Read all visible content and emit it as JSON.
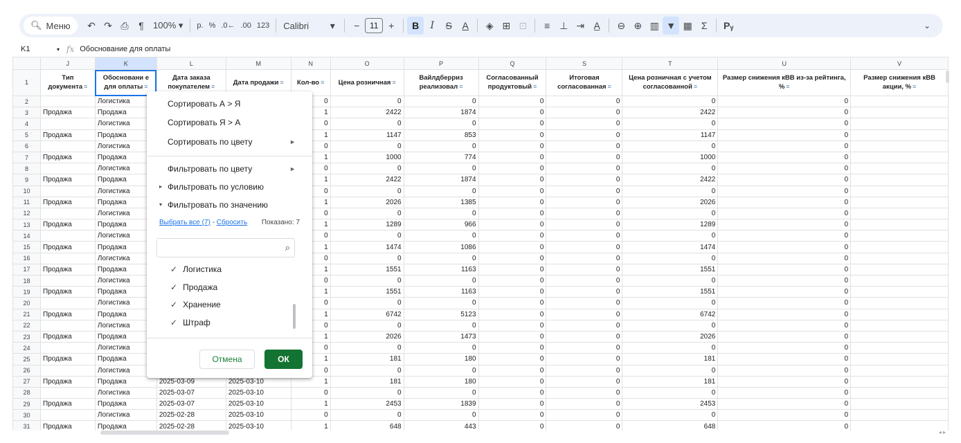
{
  "toolbar": {
    "menu_label": "Меню",
    "zoom": "100%",
    "currency": "р.",
    "percent": "%",
    "dec_less": ".0←",
    "dec_more": ".00",
    "format_num": "123",
    "font": "Calibri",
    "font_size": "11",
    "minus": "−",
    "plus": "+",
    "bold": "B",
    "italic": "I",
    "strike": "S",
    "textcolor": "A",
    "sigma": "Σ",
    "icons": [
      "search-icon",
      "undo-icon",
      "redo-icon",
      "print-icon",
      "paint-format-icon",
      "fill-color-icon",
      "borders-icon",
      "merge-icon",
      "align-icon",
      "valign-icon",
      "wrap-icon",
      "rotate-icon",
      "link-icon",
      "comment-icon",
      "chart-icon",
      "filter-icon",
      "filter-views-icon",
      "functions-icon",
      "input-tools-icon",
      "chevron-down-icon"
    ]
  },
  "formula_bar": {
    "cell": "K1",
    "fx": "fx",
    "content": "Обоснование для оплаты"
  },
  "columns": [
    {
      "letter": "J",
      "header": "Тип документа"
    },
    {
      "letter": "K",
      "header": "Обоснование для оплаты"
    },
    {
      "letter": "L",
      "header": "Дата заказа покупателем"
    },
    {
      "letter": "M",
      "header": "Дата продажи"
    },
    {
      "letter": "N",
      "header": "Кол-во"
    },
    {
      "letter": "O",
      "header": "Цена розничная"
    },
    {
      "letter": "P",
      "header": "Вайлдберриз реализовал"
    },
    {
      "letter": "Q",
      "header": "Согласованный продуктовый"
    },
    {
      "letter": "S",
      "header": "Итоговая согласованная"
    },
    {
      "letter": "T",
      "header": "Цена розничная с учетом согласованной"
    },
    {
      "letter": "U",
      "header": "Размер снижения кВВ из-за рейтинга, %"
    },
    {
      "letter": "V",
      "header": "Размер снижения кВВ акции, %"
    }
  ],
  "header_row": {
    "num": "1",
    "cells": [
      "Тип документа",
      "Обосновани е для оплаты",
      "Дата заказа покупателем",
      "Дата продажи",
      "Кол-во",
      "Цена розничная",
      "Вайлдберриз реализовал",
      "Согласованный продуктовый",
      "Итоговая согласованная",
      "Цена розничная с учетом согласованной",
      "Размер снижения кВВ из-за рейтинга, %",
      "Размер снижения кВВ акции, %"
    ]
  },
  "rows": [
    {
      "n": "2",
      "J": "",
      "K": "Логистика",
      "L": "",
      "M": "",
      "N": "0",
      "O": "0",
      "P": "0",
      "Q": "0",
      "S": "0",
      "T": "0",
      "U": "0"
    },
    {
      "n": "3",
      "J": "Продажа",
      "K": "Продажа",
      "L": "",
      "M": "",
      "N": "1",
      "O": "2422",
      "P": "1874",
      "Q": "0",
      "S": "0",
      "T": "2422",
      "U": "0"
    },
    {
      "n": "4",
      "J": "",
      "K": "Логистика",
      "L": "",
      "M": "",
      "N": "0",
      "O": "0",
      "P": "0",
      "Q": "0",
      "S": "0",
      "T": "0",
      "U": "0"
    },
    {
      "n": "5",
      "J": "Продажа",
      "K": "Продажа",
      "L": "",
      "M": "",
      "N": "1",
      "O": "1147",
      "P": "853",
      "Q": "0",
      "S": "0",
      "T": "1147",
      "U": "0"
    },
    {
      "n": "6",
      "J": "",
      "K": "Логистика",
      "L": "",
      "M": "",
      "N": "0",
      "O": "0",
      "P": "0",
      "Q": "0",
      "S": "0",
      "T": "0",
      "U": "0"
    },
    {
      "n": "7",
      "J": "Продажа",
      "K": "Продажа",
      "L": "",
      "M": "",
      "N": "1",
      "O": "1000",
      "P": "774",
      "Q": "0",
      "S": "0",
      "T": "1000",
      "U": "0"
    },
    {
      "n": "8",
      "J": "",
      "K": "Логистика",
      "L": "",
      "M": "",
      "N": "0",
      "O": "0",
      "P": "0",
      "Q": "0",
      "S": "0",
      "T": "0",
      "U": "0"
    },
    {
      "n": "9",
      "J": "Продажа",
      "K": "Продажа",
      "L": "",
      "M": "",
      "N": "1",
      "O": "2422",
      "P": "1874",
      "Q": "0",
      "S": "0",
      "T": "2422",
      "U": "0"
    },
    {
      "n": "10",
      "J": "",
      "K": "Логистика",
      "L": "",
      "M": "",
      "N": "0",
      "O": "0",
      "P": "0",
      "Q": "0",
      "S": "0",
      "T": "0",
      "U": "0"
    },
    {
      "n": "11",
      "J": "Продажа",
      "K": "Продажа",
      "L": "",
      "M": "",
      "N": "1",
      "O": "2026",
      "P": "1385",
      "Q": "0",
      "S": "0",
      "T": "2026",
      "U": "0"
    },
    {
      "n": "12",
      "J": "",
      "K": "Логистика",
      "L": "",
      "M": "",
      "N": "0",
      "O": "0",
      "P": "0",
      "Q": "0",
      "S": "0",
      "T": "0",
      "U": "0"
    },
    {
      "n": "13",
      "J": "Продажа",
      "K": "Продажа",
      "L": "",
      "M": "",
      "N": "1",
      "O": "1289",
      "P": "966",
      "Q": "0",
      "S": "0",
      "T": "1289",
      "U": "0"
    },
    {
      "n": "14",
      "J": "",
      "K": "Логистика",
      "L": "",
      "M": "",
      "N": "0",
      "O": "0",
      "P": "0",
      "Q": "0",
      "S": "0",
      "T": "0",
      "U": "0"
    },
    {
      "n": "15",
      "J": "Продажа",
      "K": "Продажа",
      "L": "",
      "M": "",
      "N": "1",
      "O": "1474",
      "P": "1086",
      "Q": "0",
      "S": "0",
      "T": "1474",
      "U": "0"
    },
    {
      "n": "16",
      "J": "",
      "K": "Логистика",
      "L": "",
      "M": "",
      "N": "0",
      "O": "0",
      "P": "0",
      "Q": "0",
      "S": "0",
      "T": "0",
      "U": "0"
    },
    {
      "n": "17",
      "J": "Продажа",
      "K": "Продажа",
      "L": "",
      "M": "",
      "N": "1",
      "O": "1551",
      "P": "1163",
      "Q": "0",
      "S": "0",
      "T": "1551",
      "U": "0"
    },
    {
      "n": "18",
      "J": "",
      "K": "Логистика",
      "L": "",
      "M": "",
      "N": "0",
      "O": "0",
      "P": "0",
      "Q": "0",
      "S": "0",
      "T": "0",
      "U": "0"
    },
    {
      "n": "19",
      "J": "Продажа",
      "K": "Продажа",
      "L": "",
      "M": "",
      "N": "1",
      "O": "1551",
      "P": "1163",
      "Q": "0",
      "S": "0",
      "T": "1551",
      "U": "0"
    },
    {
      "n": "20",
      "J": "",
      "K": "Логистика",
      "L": "",
      "M": "",
      "N": "0",
      "O": "0",
      "P": "0",
      "Q": "0",
      "S": "0",
      "T": "0",
      "U": "0"
    },
    {
      "n": "21",
      "J": "Продажа",
      "K": "Продажа",
      "L": "",
      "M": "",
      "N": "1",
      "O": "6742",
      "P": "5123",
      "Q": "0",
      "S": "0",
      "T": "6742",
      "U": "0"
    },
    {
      "n": "22",
      "J": "",
      "K": "Логистика",
      "L": "",
      "M": "",
      "N": "0",
      "O": "0",
      "P": "0",
      "Q": "0",
      "S": "0",
      "T": "0",
      "U": "0"
    },
    {
      "n": "23",
      "J": "Продажа",
      "K": "Продажа",
      "L": "",
      "M": "",
      "N": "1",
      "O": "2026",
      "P": "1473",
      "Q": "0",
      "S": "0",
      "T": "2026",
      "U": "0"
    },
    {
      "n": "24",
      "J": "",
      "K": "Логистика",
      "L": "",
      "M": "",
      "N": "0",
      "O": "0",
      "P": "0",
      "Q": "0",
      "S": "0",
      "T": "0",
      "U": "0"
    },
    {
      "n": "25",
      "J": "Продажа",
      "K": "Продажа",
      "L": "",
      "M": "",
      "N": "1",
      "O": "181",
      "P": "180",
      "Q": "0",
      "S": "0",
      "T": "181",
      "U": "0"
    },
    {
      "n": "26",
      "J": "",
      "K": "Логистика",
      "L": "",
      "M": "",
      "N": "0",
      "O": "0",
      "P": "0",
      "Q": "0",
      "S": "0",
      "T": "0",
      "U": "0"
    },
    {
      "n": "27",
      "J": "Продажа",
      "K": "Продажа",
      "L": "2025-03-09",
      "M": "2025-03-10",
      "N": "1",
      "O": "181",
      "P": "180",
      "Q": "0",
      "S": "0",
      "T": "181",
      "U": "0"
    },
    {
      "n": "28",
      "J": "",
      "K": "Логистика",
      "L": "2025-03-07",
      "M": "2025-03-10",
      "N": "0",
      "O": "0",
      "P": "0",
      "Q": "0",
      "S": "0",
      "T": "0",
      "U": "0"
    },
    {
      "n": "29",
      "J": "Продажа",
      "K": "Продажа",
      "L": "2025-03-07",
      "M": "2025-03-10",
      "N": "1",
      "O": "2453",
      "P": "1839",
      "Q": "0",
      "S": "0",
      "T": "2453",
      "U": "0"
    },
    {
      "n": "30",
      "J": "",
      "K": "Логистика",
      "L": "2025-02-28",
      "M": "2025-03-10",
      "N": "0",
      "O": "0",
      "P": "0",
      "Q": "0",
      "S": "0",
      "T": "0",
      "U": "0"
    },
    {
      "n": "31",
      "J": "Продажа",
      "K": "Продажа",
      "L": "2025-02-28",
      "M": "2025-03-10",
      "N": "1",
      "O": "648",
      "P": "443",
      "Q": "0",
      "S": "0",
      "T": "648",
      "U": "0"
    }
  ],
  "dropdown": {
    "sort_az": "Сортировать А > Я",
    "sort_za": "Сортировать Я > А",
    "sort_color": "Сортировать по цвету",
    "filter_color": "Фильтровать по цвету",
    "filter_condition": "Фильтровать по условию",
    "filter_value": "Фильтровать по значению",
    "select_all": "Выбрать все (7)",
    "link_sep": " - ",
    "reset": "Сбросить",
    "shown": "Показано: 7",
    "values": [
      "Логистика",
      "Продажа",
      "Хранение",
      "Штраф"
    ],
    "cancel": "Отмена",
    "ok": "ОК"
  }
}
